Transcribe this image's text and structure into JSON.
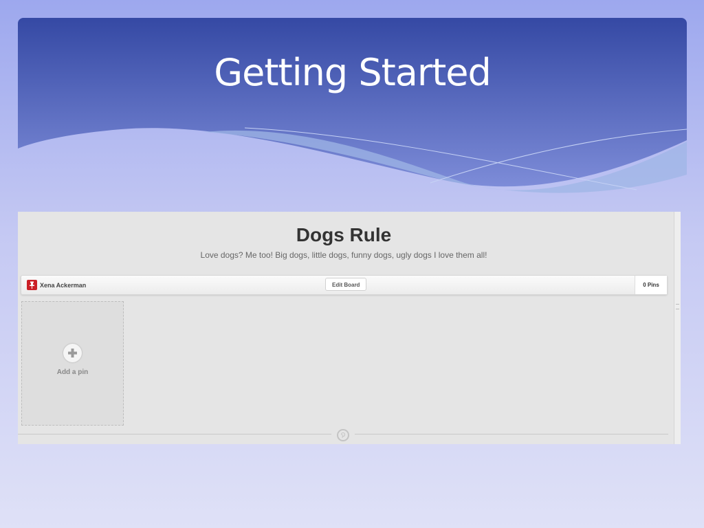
{
  "slide": {
    "title": "Getting Started"
  },
  "board": {
    "title": "Dogs Rule",
    "description": "Love dogs? Me too! Big dogs, little dogs, funny dogs, ugly dogs I love them all!",
    "owner_name": "Xena Ackerman",
    "edit_label": "Edit Board",
    "pin_count": "0 Pins",
    "add_pin_label": "Add a pin"
  },
  "icons": {
    "owner_avatar": "pushpin-icon",
    "add_pin": "plus-circle-icon",
    "footer_logo": "pinterest-logo-icon"
  },
  "colors": {
    "header_top": "#3549a4",
    "brand_red": "#cb2027",
    "page_gray": "#e5e5e5"
  }
}
